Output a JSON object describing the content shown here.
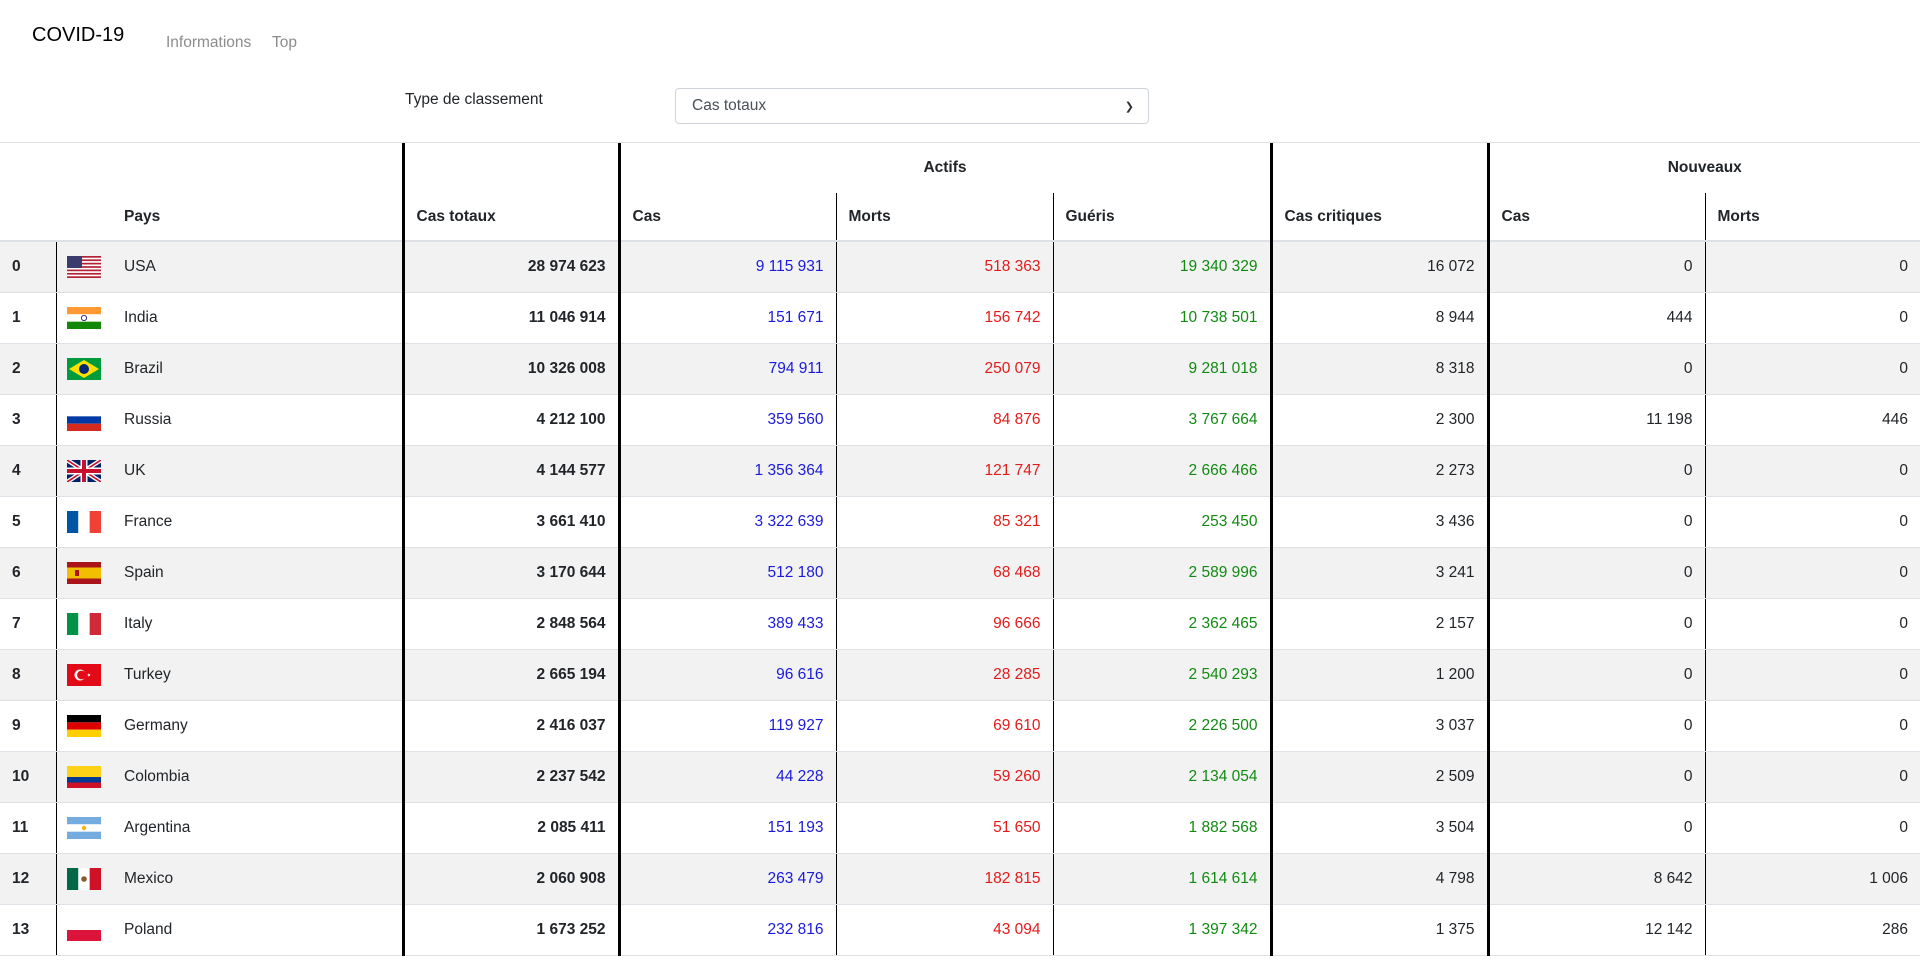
{
  "nav": {
    "brand": "COVID-19",
    "links": [
      "Informations",
      "Top"
    ]
  },
  "filter": {
    "label": "Type de classement",
    "selected": "Cas totaux"
  },
  "table": {
    "group_headers": {
      "actifs": "Actifs",
      "nouveaux": "Nouveaux"
    },
    "columns": {
      "pays": "Pays",
      "cas_totaux": "Cas totaux",
      "actifs_cas": "Cas",
      "actifs_morts": "Morts",
      "gueris": "Guéris",
      "cas_critiques": "Cas critiques",
      "nouveaux_cas": "Cas",
      "nouveaux_morts": "Morts"
    },
    "rows": [
      {
        "rank": "0",
        "flag": "usa",
        "country": "USA",
        "total": "28 974 623",
        "active": "9 115 931",
        "deaths": "518 363",
        "recovered": "19 340 329",
        "critical": "16 072",
        "new_cases": "0",
        "new_deaths": "0"
      },
      {
        "rank": "1",
        "flag": "india",
        "country": "India",
        "total": "11 046 914",
        "active": "151 671",
        "deaths": "156 742",
        "recovered": "10 738 501",
        "critical": "8 944",
        "new_cases": "444",
        "new_deaths": "0"
      },
      {
        "rank": "2",
        "flag": "brazil",
        "country": "Brazil",
        "total": "10 326 008",
        "active": "794 911",
        "deaths": "250 079",
        "recovered": "9 281 018",
        "critical": "8 318",
        "new_cases": "0",
        "new_deaths": "0"
      },
      {
        "rank": "3",
        "flag": "russia",
        "country": "Russia",
        "total": "4 212 100",
        "active": "359 560",
        "deaths": "84 876",
        "recovered": "3 767 664",
        "critical": "2 300",
        "new_cases": "11 198",
        "new_deaths": "446"
      },
      {
        "rank": "4",
        "flag": "uk",
        "country": "UK",
        "total": "4 144 577",
        "active": "1 356 364",
        "deaths": "121 747",
        "recovered": "2 666 466",
        "critical": "2 273",
        "new_cases": "0",
        "new_deaths": "0"
      },
      {
        "rank": "5",
        "flag": "france",
        "country": "France",
        "total": "3 661 410",
        "active": "3 322 639",
        "deaths": "85 321",
        "recovered": "253 450",
        "critical": "3 436",
        "new_cases": "0",
        "new_deaths": "0"
      },
      {
        "rank": "6",
        "flag": "spain",
        "country": "Spain",
        "total": "3 170 644",
        "active": "512 180",
        "deaths": "68 468",
        "recovered": "2 589 996",
        "critical": "3 241",
        "new_cases": "0",
        "new_deaths": "0"
      },
      {
        "rank": "7",
        "flag": "italy",
        "country": "Italy",
        "total": "2 848 564",
        "active": "389 433",
        "deaths": "96 666",
        "recovered": "2 362 465",
        "critical": "2 157",
        "new_cases": "0",
        "new_deaths": "0"
      },
      {
        "rank": "8",
        "flag": "turkey",
        "country": "Turkey",
        "total": "2 665 194",
        "active": "96 616",
        "deaths": "28 285",
        "recovered": "2 540 293",
        "critical": "1 200",
        "new_cases": "0",
        "new_deaths": "0"
      },
      {
        "rank": "9",
        "flag": "germany",
        "country": "Germany",
        "total": "2 416 037",
        "active": "119 927",
        "deaths": "69 610",
        "recovered": "2 226 500",
        "critical": "3 037",
        "new_cases": "0",
        "new_deaths": "0"
      },
      {
        "rank": "10",
        "flag": "colombia",
        "country": "Colombia",
        "total": "2 237 542",
        "active": "44 228",
        "deaths": "59 260",
        "recovered": "2 134 054",
        "critical": "2 509",
        "new_cases": "0",
        "new_deaths": "0"
      },
      {
        "rank": "11",
        "flag": "argentina",
        "country": "Argentina",
        "total": "2 085 411",
        "active": "151 193",
        "deaths": "51 650",
        "recovered": "1 882 568",
        "critical": "3 504",
        "new_cases": "0",
        "new_deaths": "0"
      },
      {
        "rank": "12",
        "flag": "mexico",
        "country": "Mexico",
        "total": "2 060 908",
        "active": "263 479",
        "deaths": "182 815",
        "recovered": "1 614 614",
        "critical": "4 798",
        "new_cases": "8 642",
        "new_deaths": "1 006"
      },
      {
        "rank": "13",
        "flag": "poland",
        "country": "Poland",
        "total": "1 673 252",
        "active": "232 816",
        "deaths": "43 094",
        "recovered": "1 397 342",
        "critical": "1 375",
        "new_cases": "12 142",
        "new_deaths": "286"
      }
    ]
  }
}
